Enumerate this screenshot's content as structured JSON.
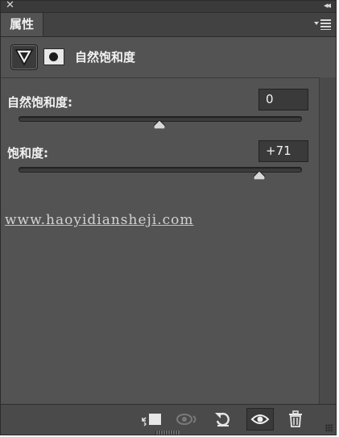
{
  "window": {
    "close_glyph": "✕",
    "collapse_glyph": "◂◂"
  },
  "tab": {
    "label": "属性"
  },
  "header": {
    "title": "自然饱和度",
    "adjustment_icon": "vibrance-triangle-icon",
    "mask_icon": "layer-mask-icon"
  },
  "controls": [
    {
      "label": "自然饱和度:",
      "value": "0",
      "min": -100,
      "max": 100,
      "current": 0
    },
    {
      "label": "饱和度:",
      "value": "+71",
      "min": -100,
      "max": 100,
      "current": 71
    }
  ],
  "watermark": {
    "text": "www.haoyidiansheji.com"
  },
  "toolbar": {
    "buttons": [
      "clip-to-layer-icon",
      "view-previous-state-icon",
      "reset-icon",
      "toggle-visibility-icon",
      "delete-icon"
    ]
  },
  "colors": {
    "panel": "#535353",
    "dark": "#3a3a3a",
    "text": "#f2f2f2"
  }
}
